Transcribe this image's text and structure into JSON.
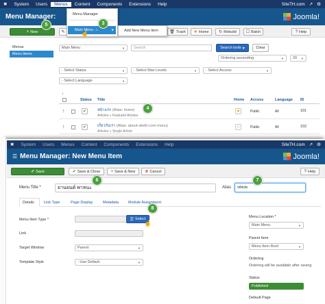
{
  "top_nav": {
    "menu": [
      "System",
      "Users",
      "Menus",
      "Content",
      "Components",
      "Extensions",
      "Help"
    ],
    "site": "SiteTH.com"
  },
  "menus_dropdown": {
    "items": [
      "Menu Manager",
      "Main Menu"
    ],
    "submenu": "Add New Menu Item"
  },
  "list_view": {
    "title": "Menu Manager:",
    "brand": "Joomla!",
    "toolbar": {
      "new": "New",
      "trash": "Trash",
      "home": "Home",
      "rebuild": "Rebuild",
      "batch": "Batch",
      "help": "Help"
    },
    "sidebar": [
      "Menus",
      "Menu Items"
    ],
    "filters": {
      "menu": "Main Menu",
      "search_placeholder": "Search",
      "search_tools": "Search tools",
      "clear": "Clear",
      "ordering": "Ordering ascending",
      "limit": "20",
      "status": "- Select Status",
      "max_levels": "- Select Max Levels",
      "access": "- Select Access",
      "language": "- Select Language"
    },
    "columns": {
      "status": "Status",
      "title": "Title",
      "home": "Home",
      "access": "Access",
      "language": "Language",
      "id": "ID"
    },
    "rows": [
      {
        "title": "หน้าแรก",
        "alias": "(Alias: home)",
        "type": "Articles » Featured Articles",
        "access": "Public",
        "language": "All",
        "id": "101"
      },
      {
        "title": "เกี่ยวกับเรา",
        "alias": "(Alias: about-siteth-com-menu)",
        "type": "Articles » Single Article",
        "access": "Public",
        "language": "All",
        "id": "102"
      }
    ]
  },
  "edit_view": {
    "title": "Menu Manager: New Menu Item",
    "brand": "Joomla!",
    "toolbar": {
      "save": "Save",
      "save_close": "Save & Close",
      "save_new": "Save & New",
      "cancel": "Cancel",
      "help": "Help"
    },
    "menu_title_label": "Menu Title *",
    "menu_title_value": "ยานยนต์ พาหนะ",
    "alias_label": "Alias",
    "alias_value": "vihicle",
    "tabs": [
      "Details",
      "Link Type",
      "Page Display",
      "Metadata",
      "Module Assignment"
    ],
    "menu_item_type_label": "Menu Item Type *",
    "select_button": "Select",
    "link_label": "Link",
    "target_window_label": "Target Window",
    "target_window_value": "Parent",
    "template_style_label": "Template Style",
    "template_style_value": "- Use Default",
    "menu_location_label": "Menu Location *",
    "menu_location_value": "Main Menu",
    "parent_item_label": "Parent Item",
    "parent_item_value": "Menu Item Root",
    "ordering_label": "Ordering",
    "ordering_note": "Ordering will be available after saving",
    "status_label": "Status",
    "status_value": "Published",
    "default_page_label": "Default Page"
  },
  "callouts": [
    "5",
    "3",
    "4",
    "6",
    "7",
    "8"
  ],
  "colors": {
    "topbar": "#1a3867",
    "header": "#17568c",
    "green": "#3c8d35",
    "callout": "#4aa13d",
    "link": "#1a56a5"
  }
}
